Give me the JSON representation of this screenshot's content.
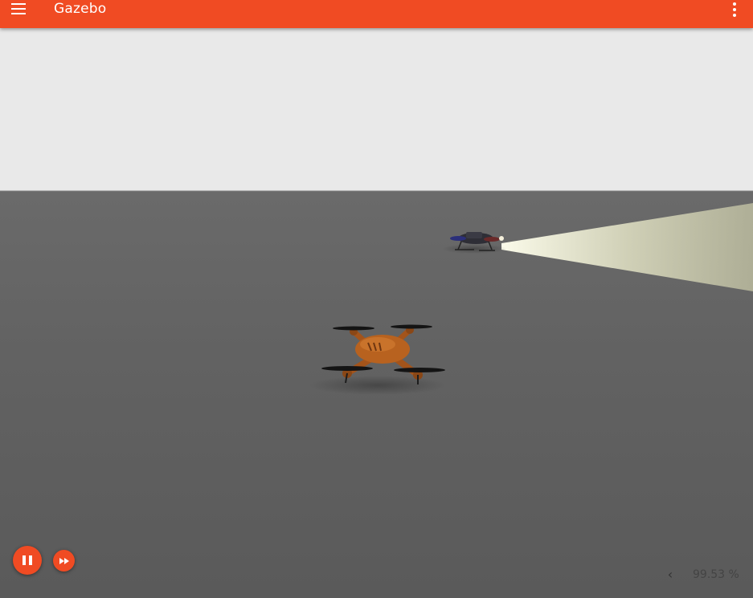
{
  "app": {
    "title": "Gazebo",
    "accent_color": "#f04b23"
  },
  "toolbar": {
    "menu_icon": "hamburger-menu-icon",
    "more_icon": "more-vertical-icon"
  },
  "scene": {
    "sky_color": "#e9e9e9",
    "ground_color": "#5f5f5f",
    "models": [
      "quadcopter-orange",
      "quadcopter-dark"
    ]
  },
  "sim_controls": {
    "pause_icon": "pause-icon",
    "step_icon": "fast-forward-icon"
  },
  "stats": {
    "toggle_glyph": "‹",
    "real_time_factor": "99.53 %"
  }
}
